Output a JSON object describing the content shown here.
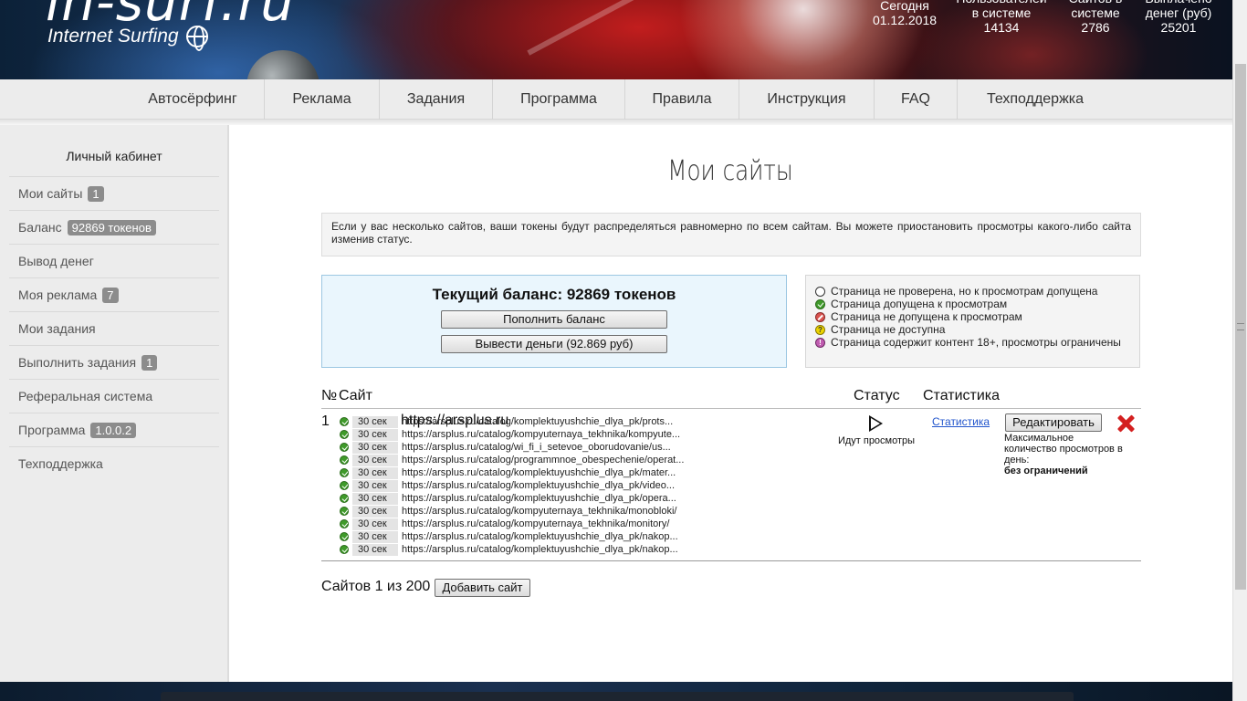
{
  "header": {
    "logo_main": "in-surf.ru",
    "logo_sub": "Internet Surfing",
    "stats": [
      {
        "label": "Сегодня",
        "value": "01.12.2018"
      },
      {
        "label": "Пользователей в системе",
        "value": "14134"
      },
      {
        "label": "Сайтов в системе",
        "value": "2786"
      },
      {
        "label": "Выплачено денег (руб)",
        "value": "25201"
      }
    ]
  },
  "nav": {
    "items": [
      "Автосёрфинг",
      "Реклама",
      "Задания",
      "Программа",
      "Правила",
      "Инструкция",
      "FAQ",
      "Техподдержка"
    ]
  },
  "sidebar": {
    "title": "Личный кабинет",
    "items": [
      {
        "label": "Мои сайты",
        "badge": "1"
      },
      {
        "label": "Баланс",
        "badge": "92869 токенов"
      },
      {
        "label": "Вывод денег",
        "badge": null
      },
      {
        "label": "Моя реклама",
        "badge": "7"
      },
      {
        "label": "Мои задания",
        "badge": null
      },
      {
        "label": "Выполнить задания",
        "badge": "1"
      },
      {
        "label": "Реферальная система",
        "badge": null
      },
      {
        "label": "Программа",
        "badge": "1.0.0.2"
      },
      {
        "label": "Техподдержка",
        "badge": null
      }
    ]
  },
  "main": {
    "title": "Мои сайты",
    "info": "Если у вас несколько сайтов, ваши токены будут распределяться равномерно по всем сайтам. Вы можете приостановить просмотры какого-либо сайта изменив статус.",
    "balance": {
      "title": "Текущий баланс: 92869 токенов",
      "topup_label": "Пополнить баланс",
      "withdraw_label": "Вывести деньги (92.869 руб)"
    },
    "legend": [
      {
        "icon": "white",
        "text": "Страница не проверена, но к просмотрам допущена"
      },
      {
        "icon": "green",
        "text": "Страница допущена к просмотрам"
      },
      {
        "icon": "red",
        "text": "Страница не допущена к просмотрам"
      },
      {
        "icon": "yellow",
        "text": "Страница не доступна"
      },
      {
        "icon": "pink",
        "text": "Страница содержит контент 18+, просмотры ограничены"
      }
    ],
    "table": {
      "col_num": "№",
      "col_site": "Сайт",
      "col_status": "Статус",
      "col_stats": "Статистика",
      "row": {
        "num": "1",
        "site": "https://arsplus.ru",
        "status_text": "Идут просмотры",
        "stats_link": "Статистика",
        "edit_label": "Редактировать",
        "limit_label": "Максимальное количество просмотров в день:",
        "limit_value": "без ограничений",
        "pages": [
          {
            "time": "30 сек",
            "url": "https://arsplus.ru/catalog/komplektuyushchie_dlya_pk/prots..."
          },
          {
            "time": "30 сек",
            "url": "https://arsplus.ru/catalog/kompyuternaya_tekhnika/kompyute..."
          },
          {
            "time": "30 сек",
            "url": "https://arsplus.ru/catalog/wi_fi_i_setevoe_oborudovanie/us..."
          },
          {
            "time": "30 сек",
            "url": "https://arsplus.ru/catalog/programmnoe_obespechenie/operat..."
          },
          {
            "time": "30 сек",
            "url": "https://arsplus.ru/catalog/komplektuyushchie_dlya_pk/mater..."
          },
          {
            "time": "30 сек",
            "url": "https://arsplus.ru/catalog/komplektuyushchie_dlya_pk/video..."
          },
          {
            "time": "30 сек",
            "url": "https://arsplus.ru/catalog/komplektuyushchie_dlya_pk/opera..."
          },
          {
            "time": "30 сек",
            "url": "https://arsplus.ru/catalog/kompyuternaya_tekhnika/monobloki/"
          },
          {
            "time": "30 сек",
            "url": "https://arsplus.ru/catalog/kompyuternaya_tekhnika/monitory/"
          },
          {
            "time": "30 сек",
            "url": "https://arsplus.ru/catalog/komplektuyushchie_dlya_pk/nakop..."
          }
        ]
      }
    },
    "footer_count": "Сайтов 1 из 200",
    "add_site_label": "Добавить сайт"
  }
}
